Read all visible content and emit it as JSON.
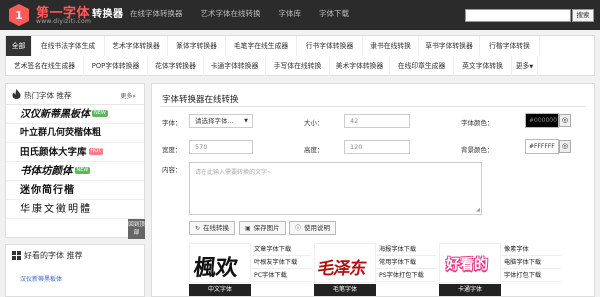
{
  "header": {
    "logo_title": "第一字体",
    "logo_accent": "转换器",
    "logo_url": "www.diyiziti.com",
    "nav": [
      "在线字体转换器",
      "艺术字体在线转换",
      "字体库",
      "字体下载"
    ],
    "search_placeholder": "",
    "search_button": "搜索"
  },
  "categories": {
    "row1": [
      "全部",
      "在线书法字体生成",
      "艺术字体转换器",
      "篆体字转换器",
      "毛笔字在线生成器",
      "行书字体转换器",
      "隶书在线转换",
      "草书字体转换器",
      "行楷字体转换"
    ],
    "row2": [
      "艺术签名在线生成器",
      "POP字体转换器",
      "花体字转换器",
      "卡通字体转换器",
      "手写体在线转换",
      "美术字体转换器",
      "在线印章生成器",
      "英文字体转换",
      "更多"
    ]
  },
  "sidebar": {
    "hot_title": "热门字体  推荐",
    "hot_more": "更多»",
    "hot_fonts": [
      {
        "label": "汉仪新蒂黑板体",
        "badge": "NEW",
        "badge_type": "new"
      },
      {
        "label": "叶立群几何荧楷体粗",
        "badge": "",
        "badge_type": ""
      },
      {
        "label": "田氏颜体大字库",
        "badge": "HOT",
        "badge_type": "hot"
      },
      {
        "label": "书体坊颜体",
        "badge": "NEW",
        "badge_type": "new"
      },
      {
        "label": "迷你简行楷",
        "badge": "",
        "badge_type": ""
      },
      {
        "label": "华康文徵明體",
        "badge": "",
        "badge_type": ""
      }
    ],
    "backtop_label": "回到顶部",
    "good_title": "好看的字体 推荐",
    "good_link": "汉仪新蒂黑板体"
  },
  "main": {
    "title": "字体转换器在线转换",
    "font_label": "字体：",
    "font_select": "请选择字体...",
    "size_label": "大小：",
    "size_value": "42",
    "font_color_label": "字体颜色：",
    "font_color_value": "#000000",
    "width_label": "宽度：",
    "width_value": "570",
    "height_label": "高度：",
    "height_value": "120",
    "bg_color_label": "背景颜色：",
    "bg_color_value": "#FFFFFF",
    "content_label": "内容：",
    "content_placeholder": "请在此输入需要转换的文字~",
    "btn_convert": "在线转换",
    "btn_save": "保存图片",
    "btn_help": "使用说明",
    "convert_icon": "refresh-icon",
    "save_icon": "image-icon",
    "help_icon": "info-icon"
  },
  "styles": [
    {
      "preview": "楓欢",
      "caption": "中文字体",
      "links": [
        "文章字体下载",
        "叶根友字体下载",
        "PC字体下载"
      ]
    },
    {
      "preview": "毛泽东",
      "caption": "毛笔字体",
      "links": [
        "海报字体下载",
        "常用字体下载",
        "PS字体打包下载"
      ]
    },
    {
      "preview": "好看的",
      "caption": "卡通字体",
      "links": [
        "像素字体",
        "电脑字体下载",
        "字体打包下载"
      ]
    }
  ],
  "colors": {
    "topbar": "#2b2b2b",
    "logo_red": "#ff5a5a",
    "active_tab": "#333333",
    "badge_new": "#5cb85c",
    "badge_hot": "#ff7a8a",
    "link": "#3366cc"
  }
}
